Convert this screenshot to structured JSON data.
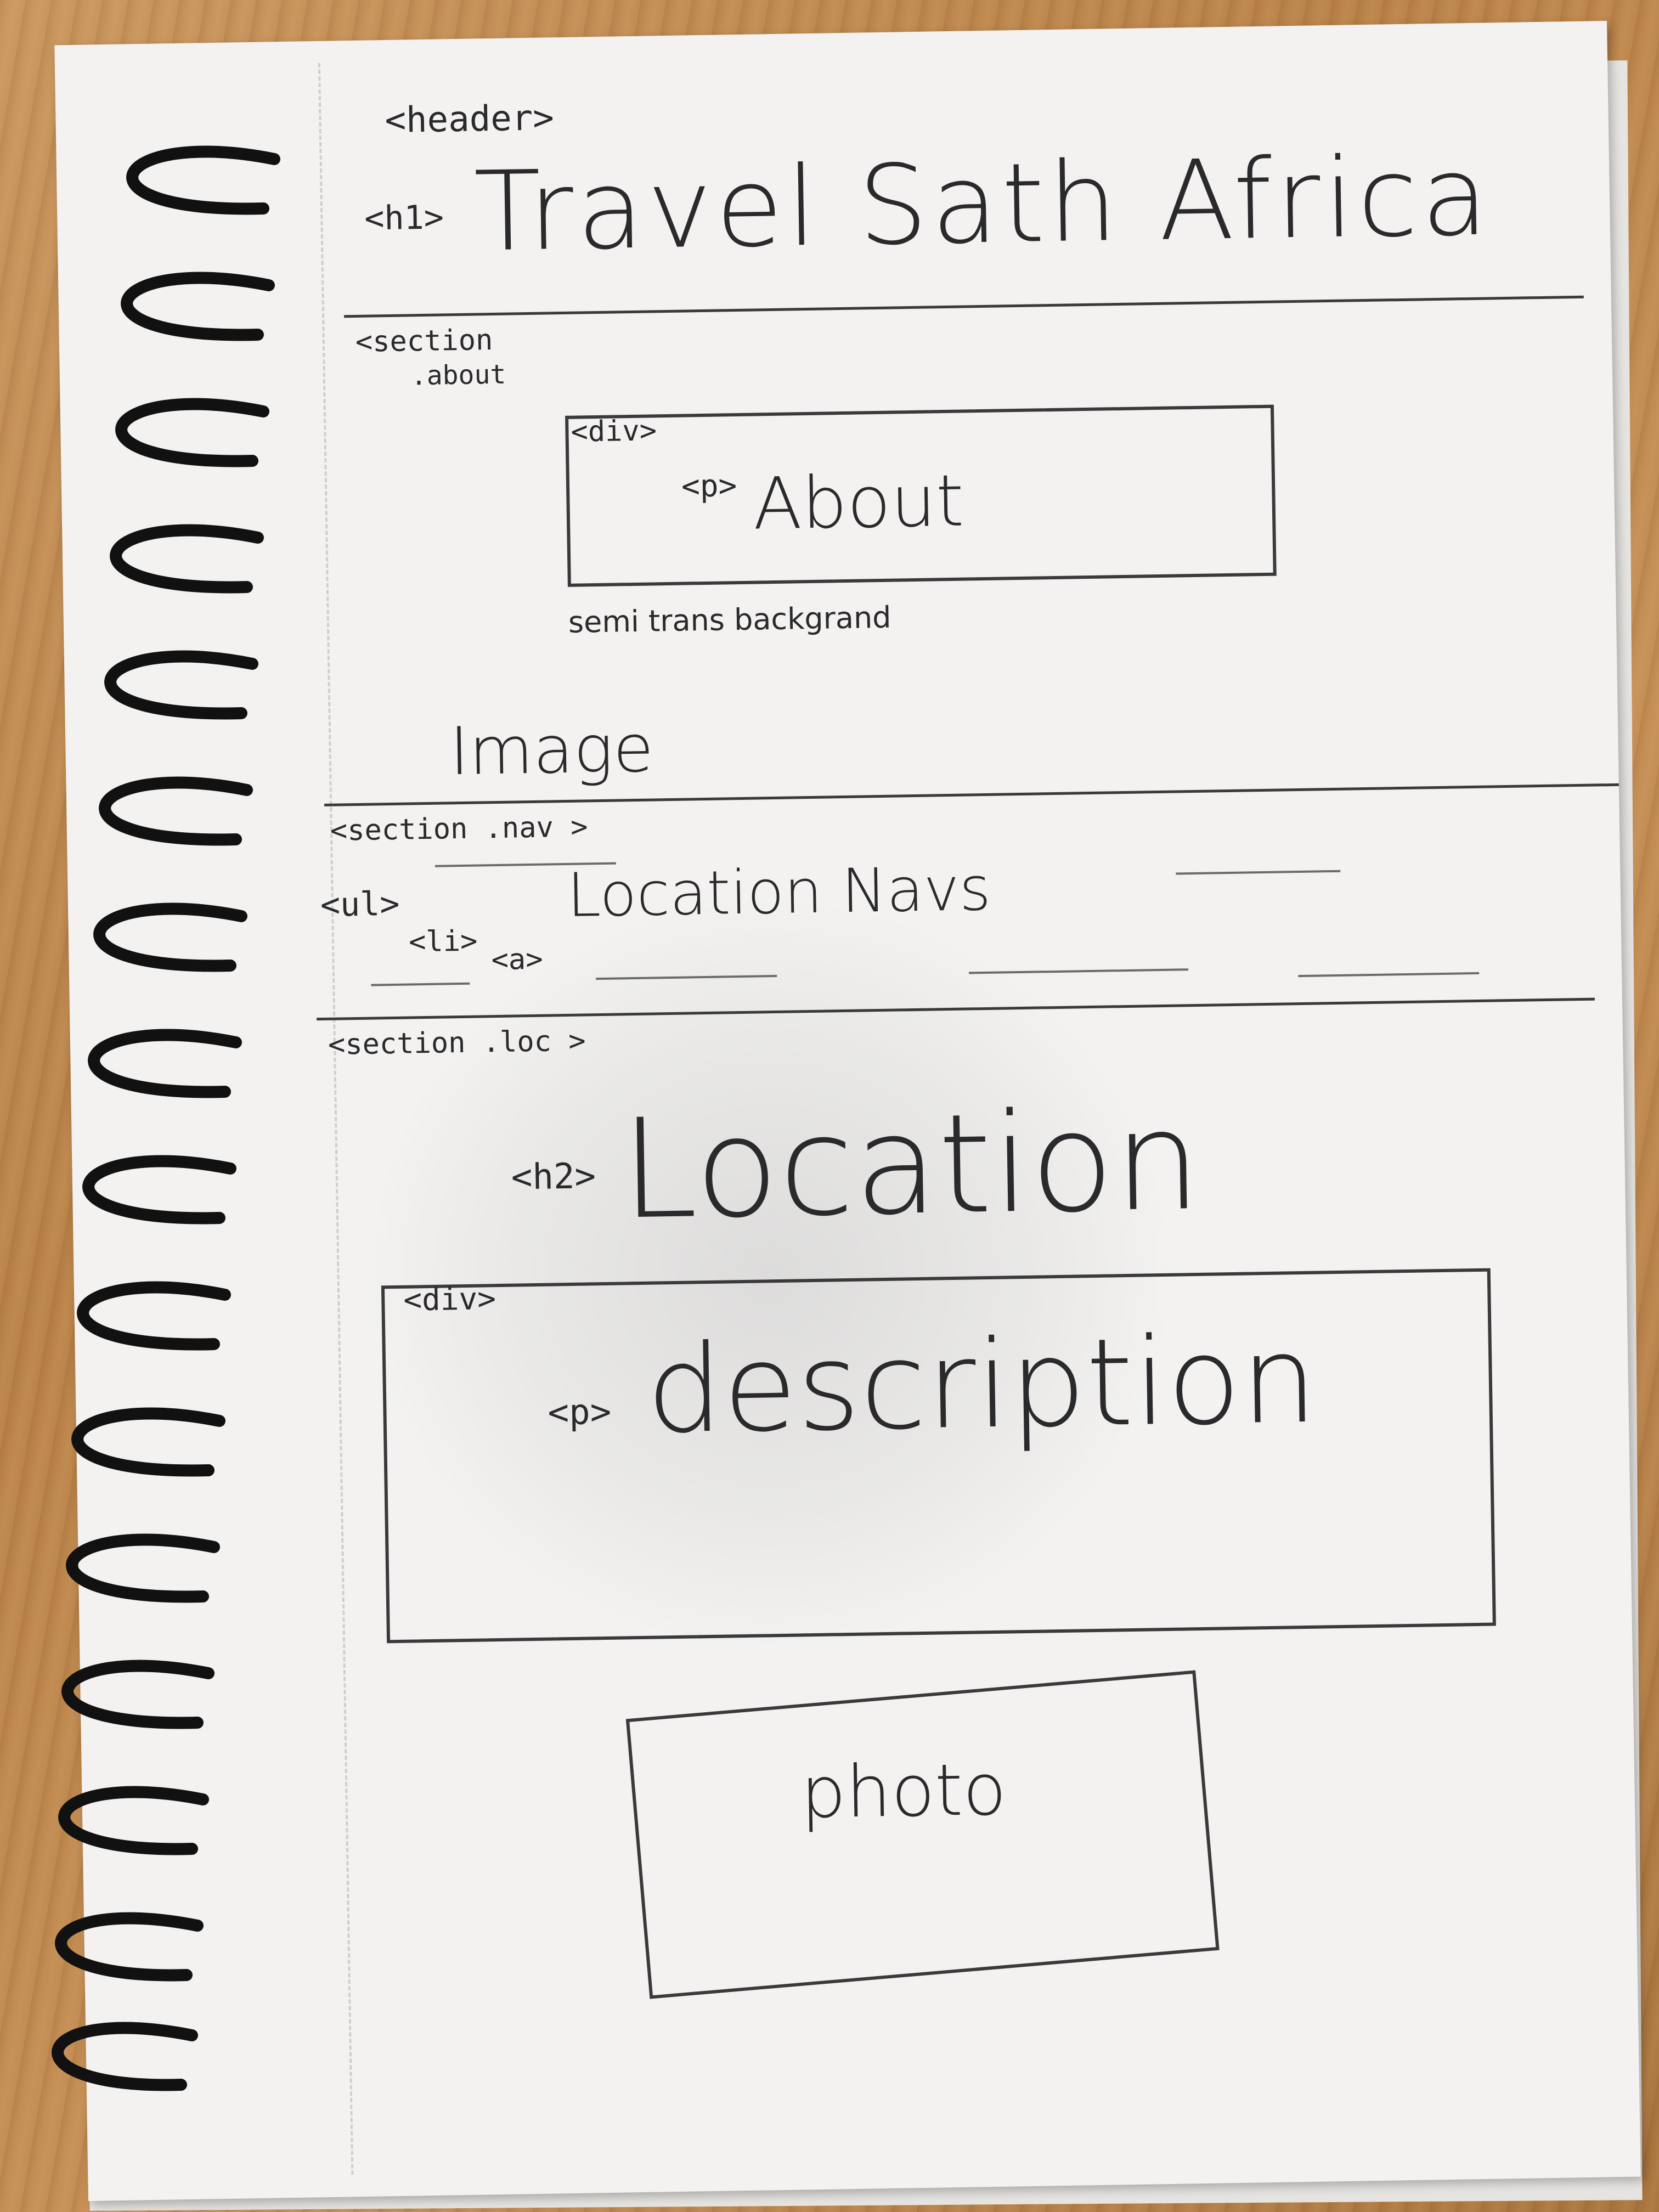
{
  "sketch": {
    "header_tag": "<header>",
    "h1_tag": "<h1>",
    "h1_text": "Travel Sath Africa",
    "about_section_tag": "<section",
    "about_section_class": ".about",
    "about_div_tag": "<div>",
    "about_p_tag": "<p>",
    "about_text": "About",
    "about_note": "semi trans backgrand",
    "image_label": "Image",
    "nav_section_tag": "<section .nav >",
    "ul_tag": "<ul>",
    "li_tag": "<li>",
    "a_tag": "<a>",
    "nav_text": "Location Navs",
    "loc_section_tag": "<section .loc >",
    "h2_tag": "<h2>",
    "h2_text": "Location",
    "desc_div_tag": "<div>",
    "desc_p_tag": "<p>",
    "desc_text": "description",
    "photo_text": "photo"
  },
  "colors": {
    "paper": "#f3f2f0",
    "pencil": "#2a2a2c",
    "wood": "#c08a50",
    "spiral": "#111111"
  }
}
